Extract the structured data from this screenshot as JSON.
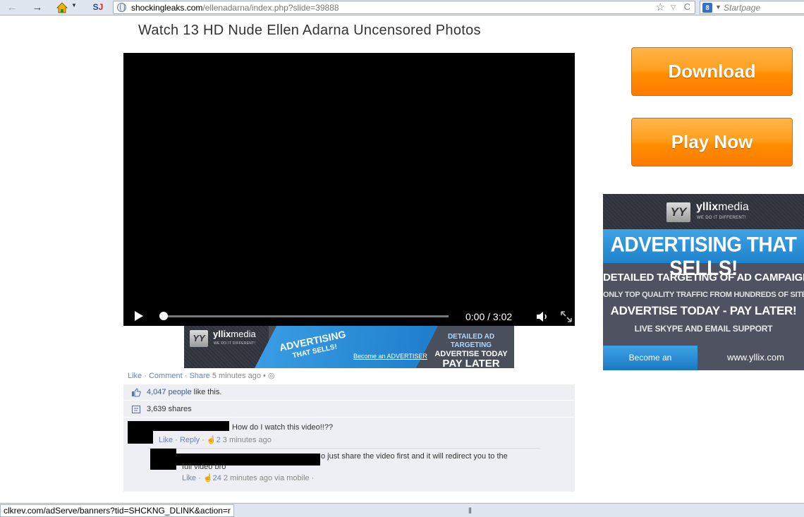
{
  "browser": {
    "url_host": "shockingleaks.com",
    "url_path": "/ellenadarna/index.php?slide=39888",
    "search_placeholder": "Startpage",
    "status_text": "clkrev.com/adServe/banners?tid=SHCKNG_DLINK&action=r"
  },
  "page": {
    "title": "Watch 13 HD Nude Ellen Adarna Uncensored Photos"
  },
  "video": {
    "time": "0:00 / 3:02",
    "progress_fraction": 0.0
  },
  "buttons": {
    "download": "Download",
    "play_now": "Play Now"
  },
  "side_ad": {
    "brand_bold": "yllix",
    "brand_light": "media",
    "tagline": "WE DO IT DIFFERENT!",
    "headline": "ADVERTISING THAT SELLS!",
    "line_1": "DETAILED TARGETING OF AD CAMPAIGNS",
    "line_2": "ONLY TOP QUALITY TRAFFIC FROM HUNDREDS OF SITES",
    "line_3": "ADVERTISE TODAY - PAY LATER!",
    "line_4": "LIVE SKYPE AND EMAIL SUPPORT",
    "cta": "Become an ADVERTISER",
    "url": "www.yllix.com"
  },
  "banner_ad": {
    "brand_bold": "yllix",
    "brand_light": "media",
    "tagline": "WE DO IT DIFFERENT!",
    "headline_1": "ADVERTISING",
    "headline_2": "THAT SELLS!",
    "cta": "Become an ADVERTISER",
    "right_1": "DETAILED AD TARGETING",
    "right_2": "ADVERTISE TODAY",
    "right_3": "PAY LATER"
  },
  "social": {
    "actions": {
      "like": "Like",
      "comment": "Comment",
      "share": "Share",
      "time": "5 minutes ago",
      "separator": " · "
    },
    "likes_count": "4,047 people",
    "likes_suffix": " like this.",
    "shares": "3,639 shares",
    "comments": [
      {
        "text": "How do I watch this video!!??",
        "like": "Like",
        "reply": "Reply",
        "count": "2",
        "time": "3 minutes ago"
      },
      {
        "text_line_1": "o just share the video first and it will redirect you to the",
        "text_line_2": "full video bro",
        "like": "Like",
        "count": "24",
        "time": "2 minutes ago via mobile"
      }
    ]
  },
  "colors": {
    "fb_link": "#3b5998",
    "cta_orange": "#ff8d00",
    "ad_blue": "#1e82cc"
  }
}
